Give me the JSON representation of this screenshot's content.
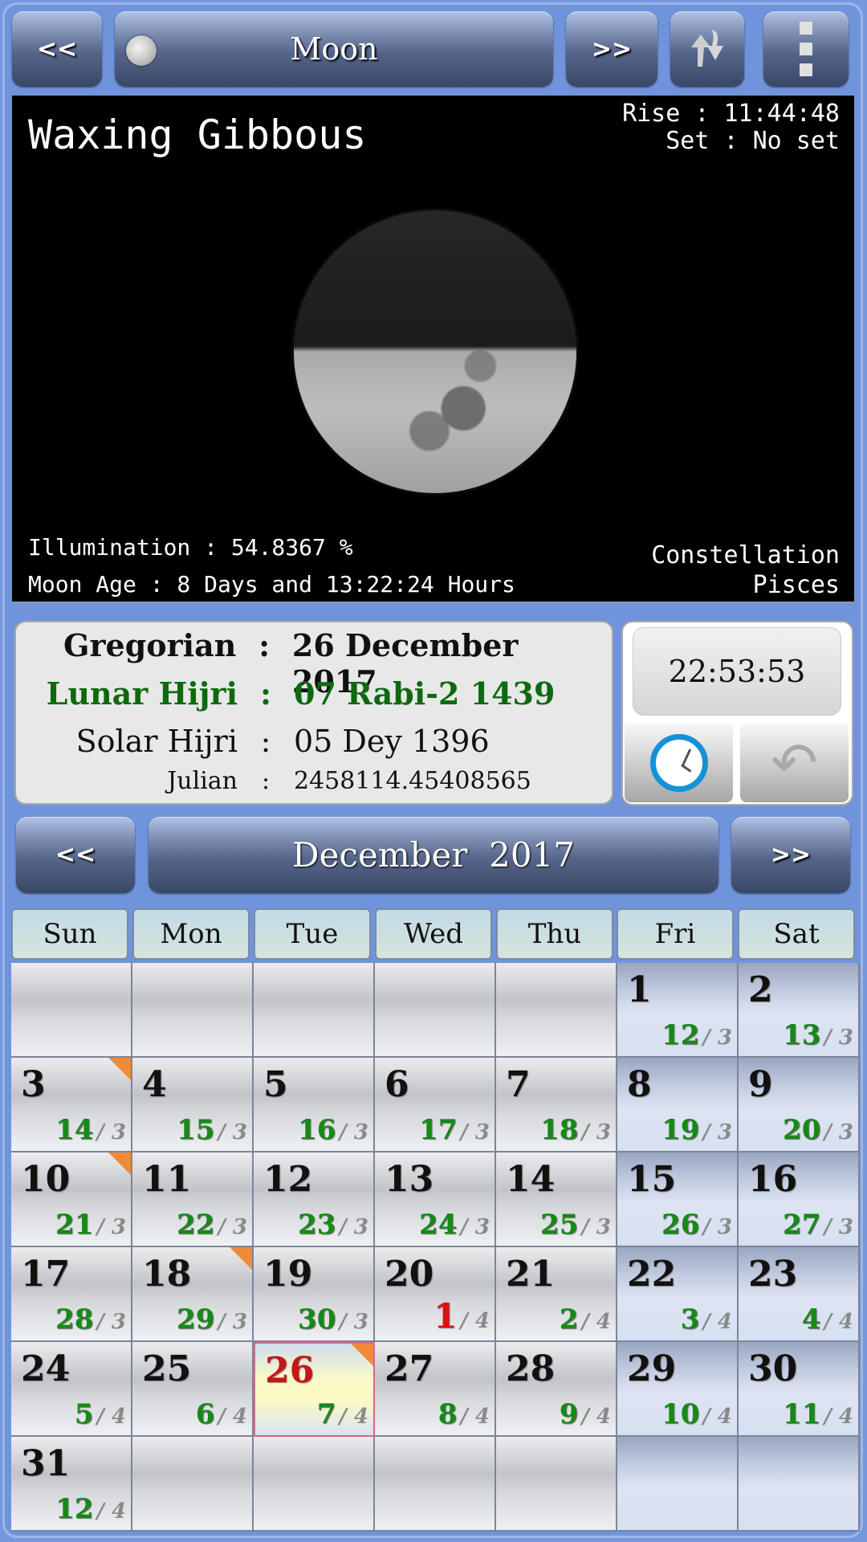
{
  "toolbar": {
    "prev_label": "<<",
    "title": "Moon",
    "next_label": ">>",
    "swap_icon": "swap-arrows-icon",
    "menu_icon": "overflow-menu-icon"
  },
  "moon": {
    "phase": "Waxing Gibbous",
    "rise": "Rise : 11:44:48",
    "set": "Set : No set",
    "illumination": "Illumination : 54.8367 %",
    "age": "Moon Age : 8 Days and 13:22:24 Hours",
    "constellation_label": "Constellation",
    "constellation": "Pisces",
    "illumination_percent": 54.8367
  },
  "dates": [
    {
      "label": "Gregorian",
      "colon": ":",
      "value": "26 December 2017"
    },
    {
      "label": "Lunar Hijri",
      "colon": ":",
      "value": "07 Rabi-2 1439"
    },
    {
      "label": "Solar Hijri",
      "colon": ":",
      "value": "05 Dey 1396"
    },
    {
      "label": "Julian",
      "colon": ":",
      "value": "2458114.45408565"
    }
  ],
  "clock": {
    "time": "22:53:53",
    "clock_icon": "clock-icon",
    "back_icon": "back-arrow-icon"
  },
  "month_nav": {
    "prev_label": "<<",
    "title": "December  2017",
    "next_label": ">>"
  },
  "weekdays": [
    "Sun",
    "Mon",
    "Tue",
    "Wed",
    "Thu",
    "Fri",
    "Sat"
  ],
  "calendar": {
    "today": 26,
    "leading_blanks": 5,
    "days": [
      {
        "d": "1",
        "h": "12",
        "m": "3"
      },
      {
        "d": "2",
        "h": "13",
        "m": "3"
      },
      {
        "d": "3",
        "h": "14",
        "m": "3",
        "mark": true
      },
      {
        "d": "4",
        "h": "15",
        "m": "3"
      },
      {
        "d": "5",
        "h": "16",
        "m": "3"
      },
      {
        "d": "6",
        "h": "17",
        "m": "3"
      },
      {
        "d": "7",
        "h": "18",
        "m": "3"
      },
      {
        "d": "8",
        "h": "19",
        "m": "3"
      },
      {
        "d": "9",
        "h": "20",
        "m": "3"
      },
      {
        "d": "10",
        "h": "21",
        "m": "3",
        "mark": true
      },
      {
        "d": "11",
        "h": "22",
        "m": "3"
      },
      {
        "d": "12",
        "h": "23",
        "m": "3"
      },
      {
        "d": "13",
        "h": "24",
        "m": "3"
      },
      {
        "d": "14",
        "h": "25",
        "m": "3"
      },
      {
        "d": "15",
        "h": "26",
        "m": "3"
      },
      {
        "d": "16",
        "h": "27",
        "m": "3"
      },
      {
        "d": "17",
        "h": "28",
        "m": "3"
      },
      {
        "d": "18",
        "h": "29",
        "m": "3",
        "mark": true
      },
      {
        "d": "19",
        "h": "30",
        "m": "3"
      },
      {
        "d": "20",
        "h": "1",
        "m": "4",
        "red": true
      },
      {
        "d": "21",
        "h": "2",
        "m": "4"
      },
      {
        "d": "22",
        "h": "3",
        "m": "4"
      },
      {
        "d": "23",
        "h": "4",
        "m": "4"
      },
      {
        "d": "24",
        "h": "5",
        "m": "4"
      },
      {
        "d": "25",
        "h": "6",
        "m": "4"
      },
      {
        "d": "26",
        "h": "7",
        "m": "4",
        "mark": true
      },
      {
        "d": "27",
        "h": "8",
        "m": "4"
      },
      {
        "d": "28",
        "h": "9",
        "m": "4"
      },
      {
        "d": "29",
        "h": "10",
        "m": "4"
      },
      {
        "d": "30",
        "h": "11",
        "m": "4"
      },
      {
        "d": "31",
        "h": "12",
        "m": "4"
      }
    ],
    "separator": "/"
  }
}
